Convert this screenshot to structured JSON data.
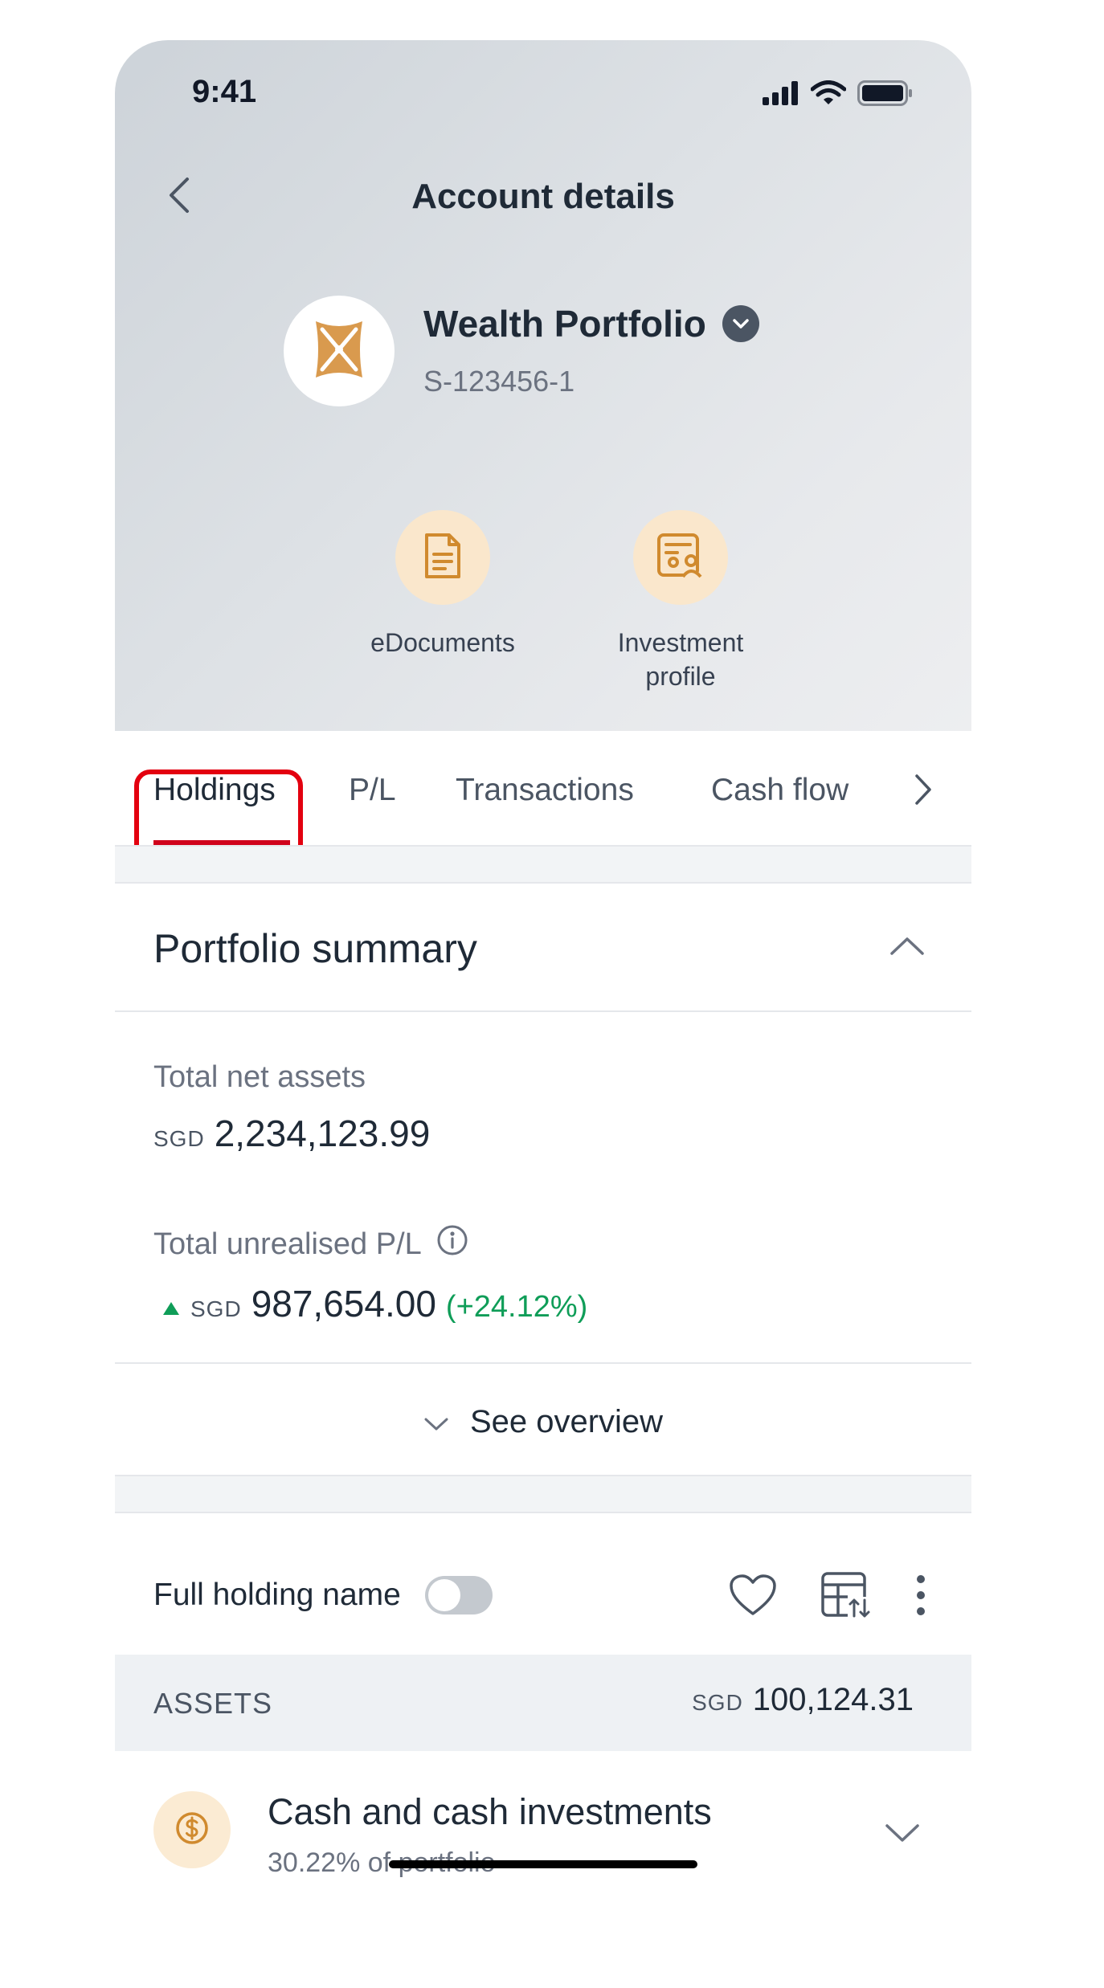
{
  "status_bar": {
    "time": "9:41",
    "icons": [
      "cellular-signal-icon",
      "wifi-icon",
      "battery-icon"
    ]
  },
  "nav": {
    "title": "Account details",
    "back_icon": "chevron-left-icon"
  },
  "account": {
    "name": "Wealth Portfolio",
    "number": "S-123456-1",
    "logo_icon": "bank-logo-icon",
    "dropdown_icon": "chevron-down-icon",
    "logo_color": "#d99a4e"
  },
  "quick_actions": [
    {
      "label": "eDocuments",
      "icon": "document-icon"
    },
    {
      "label": "Investment profile",
      "icon": "profile-card-icon"
    }
  ],
  "tabs": [
    {
      "label": "Holdings",
      "active": true
    },
    {
      "label": "P/L"
    },
    {
      "label": "Transactions"
    },
    {
      "label": "Cash flow"
    }
  ],
  "tabs_more_icon": "chevron-right-icon",
  "summary": {
    "title": "Portfolio summary",
    "total_net_assets_label": "Total net assets",
    "total_net_assets_ccy": "SGD",
    "total_net_assets_value": "2,234,123.99",
    "unrealised_label": "Total unrealised P/L",
    "unrealised_ccy": "SGD",
    "unrealised_value": "987,654.00",
    "unrealised_pct": "(+24.12%)",
    "see_overview": "See overview"
  },
  "holdings_controls": {
    "full_name_label": "Full holding name",
    "full_name_toggle_on": false
  },
  "assets": {
    "label": "ASSETS",
    "ccy": "SGD",
    "value": "100,124.31"
  },
  "categories": [
    {
      "title": "Cash and cash investments",
      "subtitle": "30.22% of portfolio",
      "icon": "dollar-coin-icon"
    }
  ],
  "colors": {
    "accent_red": "#d0021b",
    "highlight_red": "#e3000f",
    "gain_green": "#0f9d58",
    "gold": "#d99a4e",
    "gold_light": "#fae7cc"
  }
}
